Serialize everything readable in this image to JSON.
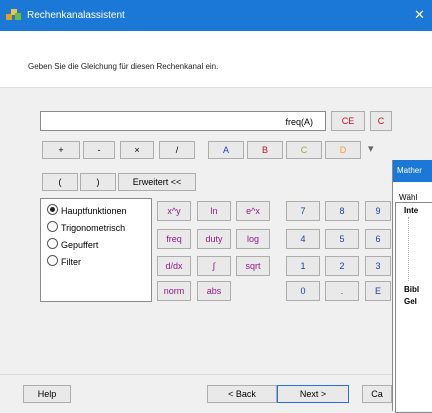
{
  "window": {
    "title": "Rechenkanalassistent",
    "close": "✕"
  },
  "instruction": "Geben Sie die Gleichung für diesen Rechenkanal ein.",
  "formula": {
    "value": "freq(A)"
  },
  "row1": {
    "ce": "CE",
    "c": "C",
    "plus": "+",
    "minus": "-",
    "times": "×",
    "div": "/",
    "a": "A",
    "b": "B",
    "cc": "C",
    "d": "D",
    "dropdown": "▾"
  },
  "row2": {
    "lparen": "(",
    "rparen": ")",
    "extended": "Erweitert <<"
  },
  "categories": [
    "Hauptfunktionen",
    "Trigonometrisch",
    "Gepuffert",
    "Filter"
  ],
  "functions": [
    [
      "x^y",
      "ln",
      "e^x"
    ],
    [
      "freq",
      "duty",
      "log"
    ],
    [
      "d/dx",
      "∫",
      "sqrt"
    ],
    [
      "norm",
      "abs"
    ]
  ],
  "numpad": [
    [
      "7",
      "8",
      "9"
    ],
    [
      "4",
      "5",
      "6"
    ],
    [
      "1",
      "2",
      "3"
    ],
    [
      "0",
      ".",
      "E"
    ]
  ],
  "popup": {
    "title": "Mather",
    "label": "Wähl",
    "inte": "Inte",
    "bibl": "Bibl",
    "gel": "Gel"
  },
  "footer": {
    "help": "Help",
    "back": "< Back",
    "next": "Next >",
    "cancel": "Ca"
  }
}
